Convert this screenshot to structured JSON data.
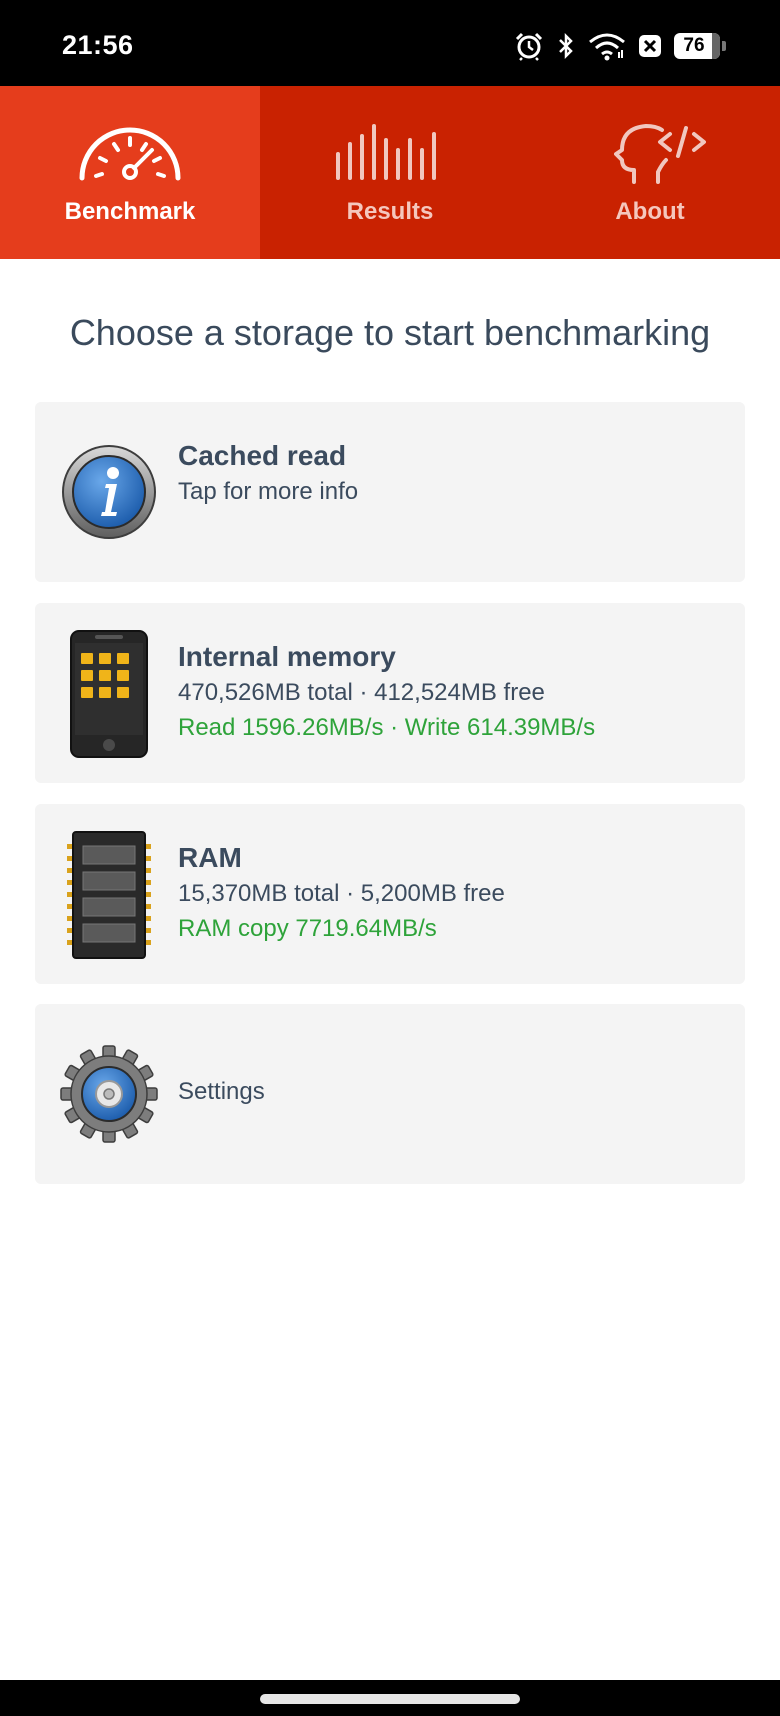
{
  "status_bar": {
    "time": "21:56",
    "battery": "76",
    "icons": [
      "alarm-icon",
      "bluetooth-icon",
      "wifi-icon",
      "notification-x-icon",
      "battery-icon"
    ]
  },
  "tabs": [
    {
      "label": "Benchmark",
      "icon": "speedometer-icon",
      "active": true
    },
    {
      "label": "Results",
      "icon": "bars-icon",
      "active": false
    },
    {
      "label": "About",
      "icon": "head-code-icon",
      "active": false
    }
  ],
  "heading": "Choose a storage to start benchmarking",
  "cards": {
    "cached_read": {
      "icon": "info-icon",
      "title": "Cached read",
      "subtitle": "Tap for more info"
    },
    "internal_memory": {
      "icon": "phone-icon",
      "title": "Internal memory",
      "size_line": "470,526MB total · 412,524MB free",
      "speed_line": "Read 1596.26MB/s · Write 614.39MB/s"
    },
    "ram": {
      "icon": "ram-chip-icon",
      "title": "RAM",
      "size_line": "15,370MB total · 5,200MB free",
      "speed_line": "RAM copy 7719.64MB/s"
    },
    "settings": {
      "icon": "gear-icon",
      "label": "Settings"
    }
  },
  "colors": {
    "tab_bar": "#c92201",
    "tab_active": "#e53d1c",
    "text": "#3b4b5e",
    "speed_green": "#2ea33a",
    "card_bg": "#f4f4f4"
  }
}
